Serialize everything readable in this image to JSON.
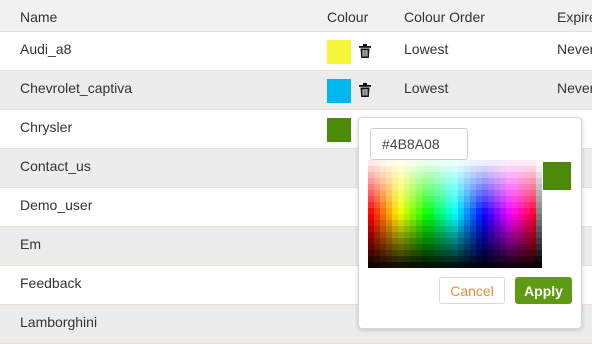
{
  "table": {
    "headers": {
      "name": "Name",
      "colour": "Colour",
      "colour_order": "Colour Order",
      "expire": "Expire"
    },
    "rows": [
      {
        "name": "Audi_a8",
        "colour": "#f5f53a",
        "order": "Lowest",
        "expire": "Never",
        "has_trash": true
      },
      {
        "name": "Chevrolet_captiva",
        "colour": "#00b8ef",
        "order": "Lowest",
        "expire": "Never",
        "has_trash": true
      },
      {
        "name": "Chrysler",
        "colour": "#4b8a08",
        "order": "",
        "expire": "",
        "has_trash": false
      },
      {
        "name": "Contact_us",
        "colour": "",
        "order": "",
        "expire": "",
        "has_trash": false
      },
      {
        "name": "Demo_user",
        "colour": "",
        "order": "",
        "expire": "",
        "has_trash": false
      },
      {
        "name": "Em",
        "colour": "",
        "order": "",
        "expire": "",
        "has_trash": false
      },
      {
        "name": "Feedback",
        "colour": "",
        "order": "",
        "expire": "",
        "has_trash": false
      },
      {
        "name": "Lamborghini",
        "colour": "",
        "order": "",
        "expire": "",
        "has_trash": false
      }
    ]
  },
  "color_picker": {
    "hex_value": "#4B8A08",
    "preview_color": "#4b8a08",
    "cancel_label": "Cancel",
    "apply_label": "Apply"
  },
  "icons": {
    "trash": "trash-icon"
  },
  "colors": {
    "accent_green": "#5f9a14",
    "cancel_orange": "#f0883a"
  }
}
